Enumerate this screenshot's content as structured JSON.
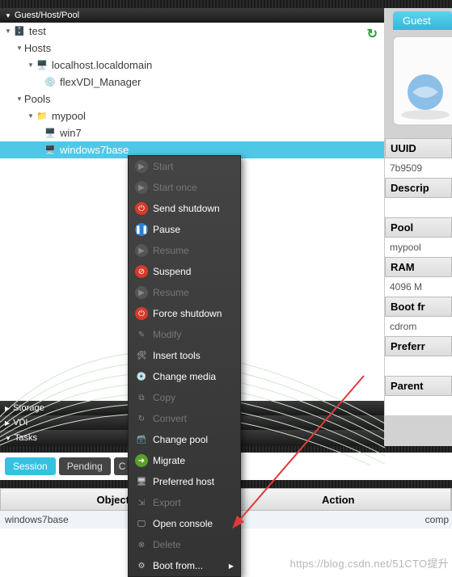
{
  "panels": {
    "tree_title": "Guest/Host/Pool",
    "storage": "Storage",
    "vdi": "VDI",
    "tasks": "Tasks"
  },
  "tree": {
    "root": "test",
    "hosts_label": "Hosts",
    "host1": "localhost.localdomain",
    "host1_sub": "flexVDI_Manager",
    "pools_label": "Pools",
    "pool1": "mypool",
    "pool1_a": "win7",
    "pool1_b": "windows7base"
  },
  "ctx": {
    "start": "Start",
    "start_once": "Start once",
    "send_shutdown": "Send shutdown",
    "pause": "Pause",
    "resume1": "Resume",
    "suspend": "Suspend",
    "resume2": "Resume",
    "force_shutdown": "Force shutdown",
    "modify": "Modify",
    "insert_tools": "Insert tools",
    "change_media": "Change media",
    "copy": "Copy",
    "convert": "Convert",
    "change_pool": "Change pool",
    "migrate": "Migrate",
    "preferred_host": "Preferred host",
    "export": "Export",
    "open_console": "Open console",
    "delete": "Delete",
    "boot_from": "Boot from..."
  },
  "tabs": {
    "session": "Session",
    "pending": "Pending",
    "cut": "C"
  },
  "table": {
    "col_object": "Object",
    "col_action": "Action",
    "row1_obj": "windows7base",
    "row1_act": "comp"
  },
  "right": {
    "tab": "Guest",
    "uuid_k": "UUID",
    "uuid_v": "7b9509",
    "desc_k": "Descrip",
    "pool_k": "Pool",
    "pool_v": "mypool",
    "ram_k": "RAM",
    "ram_v": "4096 M",
    "boot_k": "Boot fr",
    "boot_v": "cdrom",
    "pref_k": "Preferr",
    "parent_k": "Parent"
  },
  "watermark": "https://blog.csdn.net/51CTO提升"
}
